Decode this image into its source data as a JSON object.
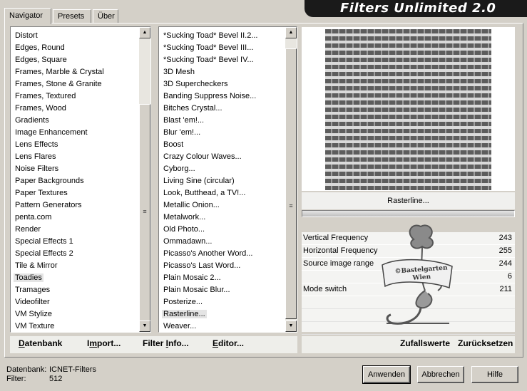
{
  "tabs": [
    "Navigator",
    "Presets",
    "Über"
  ],
  "active_tab": 0,
  "app_title": "Filters Unlimited 2.0",
  "categories": {
    "items": [
      "Distort",
      "Edges, Round",
      "Edges, Square",
      "Frames, Marble & Crystal",
      "Frames, Stone & Granite",
      "Frames, Textured",
      "Frames, Wood",
      "Gradients",
      "Image Enhancement",
      "Lens Effects",
      "Lens Flares",
      "Noise Filters",
      "Paper Backgrounds",
      "Paper Textures",
      "Pattern Generators",
      "penta.com",
      "Render",
      "Special Effects 1",
      "Special Effects 2",
      "Tile & Mirror",
      "Toadies",
      "Tramages",
      "Videofilter",
      "VM Stylize",
      "VM Texture"
    ],
    "selected": "Toadies"
  },
  "filters": {
    "items": [
      "*Sucking Toad*  Bevel II.2...",
      "*Sucking Toad*  Bevel III...",
      "*Sucking Toad*  Bevel IV...",
      "3D Mesh",
      "3D Supercheckers",
      "Banding Suppress Noise...",
      "Bitches Crystal...",
      "Blast 'em!...",
      "Blur 'em!...",
      "Boost",
      "Crazy Colour Waves...",
      "Cyborg...",
      "Living Sine (circular)",
      "Look, Butthead, a TV!...",
      "Metallic Onion...",
      "Metalwork...",
      "Old Photo...",
      "Ommadawn...",
      "Picasso's Another Word...",
      "Picasso's Last Word...",
      "Plain Mosaic 2...",
      "Plain Mosaic Blur...",
      "Posterize...",
      "Rasterline...",
      "Weaver..."
    ],
    "selected": "Rasterline..."
  },
  "preview": {
    "filter_name": "Rasterline...",
    "stripe_dark": "#5d5d5d",
    "stripe_light": "#dadada"
  },
  "params": [
    {
      "label": "Vertical Frequency",
      "value": "243"
    },
    {
      "label": "Horizontal Frequency",
      "value": "255"
    },
    {
      "label": "Source image range",
      "value": "244"
    },
    {
      "label": "",
      "value": "6"
    },
    {
      "label": "Mode switch",
      "value": "211"
    },
    {
      "label": "",
      "value": ""
    },
    {
      "label": "",
      "value": ""
    },
    {
      "label": "",
      "value": ""
    }
  ],
  "watermark": {
    "line1": "©Bastelgarten",
    "line2": "Wien"
  },
  "left_buttons": {
    "datenbank": {
      "accel": "D",
      "rest": "atenbank"
    },
    "import": {
      "pre": "I",
      "accel": "m",
      "rest": "port..."
    },
    "filter_info": {
      "pre": "Filter ",
      "accel": "I",
      "rest": "nfo..."
    },
    "editor": {
      "accel": "E",
      "rest": "ditor..."
    }
  },
  "right_buttons": {
    "zufallswerte": "Zufallswerte",
    "zuruecksetzen": "Zurücksetzen"
  },
  "status": {
    "db_label": "Datenbank:",
    "db_value": "ICNET-Filters",
    "filter_label": "Filter:",
    "filter_value": "512"
  },
  "dialog_buttons": {
    "apply": "Anwenden",
    "cancel": "Abbrechen",
    "help": "Hilfe"
  },
  "icons": {
    "scroll_up": "arrow-up-icon",
    "scroll_down": "arrow-down-icon",
    "grip": "scroll-grip-icon"
  }
}
